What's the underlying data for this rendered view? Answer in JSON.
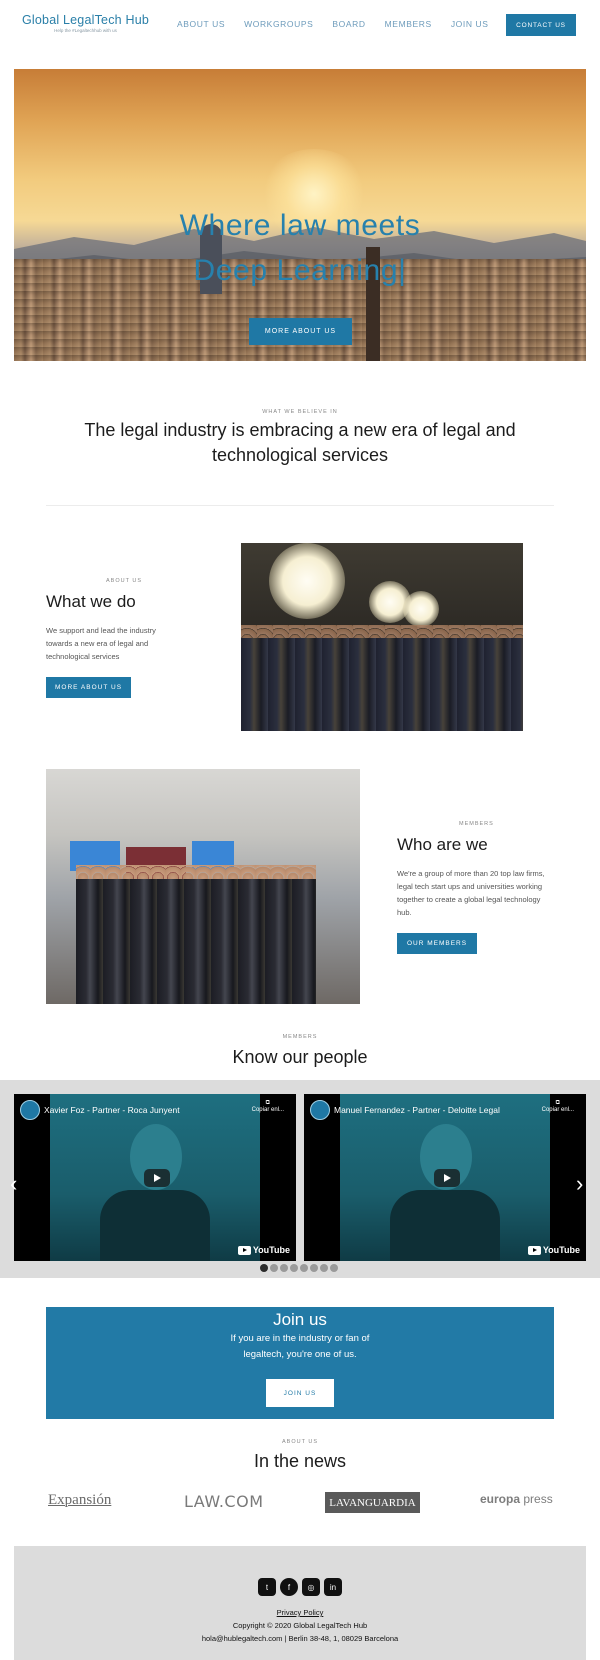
{
  "header": {
    "logo_title": "Global LegalTech Hub",
    "logo_subtitle": "Help the #Legaltechhub with us",
    "nav": [
      "ABOUT US",
      "WORKGROUPS",
      "BOARD",
      "MEMBERS",
      "JOIN US"
    ],
    "contact_label": "CONTACT US"
  },
  "hero": {
    "title_line1": "Where law meets",
    "title_line2": "Deep Learning|",
    "button_label": "MORE ABOUT US"
  },
  "belief": {
    "eyebrow": "WHAT WE BELIEVE IN",
    "title": "The legal industry is embracing a new era of legal and technological services"
  },
  "what_we_do": {
    "eyebrow": "ABOUT US",
    "title": "What we do",
    "text": "We support and lead the industry towards a new era of legal and technological services",
    "button_label": "MORE ABOUT US"
  },
  "who_are_we": {
    "eyebrow": "MEMBERS",
    "title": "Who are we",
    "text": "We're a  group of more than 20 top law firms, legal tech start ups and universities working together to create a global legal technology hub.",
    "button_label": "OUR MEMBERS"
  },
  "people": {
    "eyebrow": "MEMBERS",
    "title": "Know our people",
    "videos": [
      {
        "title": "Xavier Foz - Partner - Roca Junyent",
        "copy": "Copiar enl...",
        "brand": "YouTube"
      },
      {
        "title": "Manuel Fernandez - Partner - Deloitte Legal",
        "copy": "Copiar enl...",
        "brand": "YouTube"
      }
    ],
    "dots_count": 8,
    "active_dot": 0,
    "prev_icon": "chevron-left-icon",
    "next_icon": "chevron-right-icon"
  },
  "join": {
    "title": "Join us",
    "text_line1": "If you are in the industry or fan of",
    "text_line2": "legaltech, you're one of us.",
    "button_label": "JOIN US"
  },
  "news": {
    "eyebrow": "ABOUT US",
    "title": "In the news",
    "outlets": [
      "Expansión",
      "LAW.COM",
      "LAVANGUARDIA",
      "europa",
      "press"
    ]
  },
  "footer": {
    "social_icons": [
      "twitter-icon",
      "facebook-icon",
      "instagram-icon",
      "linkedin-icon"
    ],
    "privacy_label": "Privacy Policy",
    "copyright": "Copyright © 2020 Global LegalTech Hub",
    "contact": "hola@hublegaltech.com | Berlin 38-48, 1, 08029 Barcelona"
  },
  "colors": {
    "brand": "#1f78a5",
    "hero_title": "#2781ad",
    "footer_bg": "#dcdcdc"
  }
}
